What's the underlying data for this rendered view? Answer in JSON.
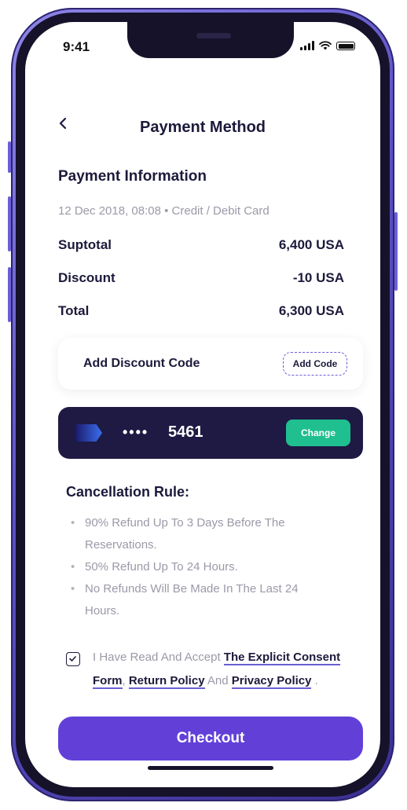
{
  "status_bar": {
    "time": "9:41"
  },
  "header": {
    "title": "Payment Method"
  },
  "payment_info": {
    "title": "Payment Information",
    "meta": "12 Dec 2018, 08:08 • Credit / Debit Card",
    "rows": [
      {
        "label": "Suptotal",
        "value": "6,400 USA"
      },
      {
        "label": "Discount",
        "value": "-10 USA"
      },
      {
        "label": "Total",
        "value": "6,300 USA"
      }
    ]
  },
  "discount": {
    "label": "Add Discount Code",
    "button": "Add Code"
  },
  "card": {
    "masked": "••••",
    "last4": "5461",
    "change_label": "Change"
  },
  "cancellation": {
    "title": "Cancellation Rule:",
    "rules": [
      "90% Refund Up To 3 Days Before The Reservations.",
      "50% Refund Up To 24 Hours.",
      "No Refunds Will Be Made In The Last 24 Hours."
    ]
  },
  "consent": {
    "prefix": "I Have Read And Accept ",
    "link1": "The Explicit Consent Form",
    "sep": ", ",
    "link2": "Return Policy",
    "and": " And ",
    "link3": "Privacy Policy",
    "suffix": " .",
    "checked": true
  },
  "checkout": {
    "label": "Checkout"
  },
  "colors": {
    "primary": "#6240d8",
    "card_bg": "#1e1a44",
    "change_green": "#1fbf8f",
    "text_dark": "#1c1a3b",
    "text_muted": "#9a9aa8"
  },
  "icons": [
    "back-chevron-icon",
    "signal-icon",
    "wifi-icon",
    "battery-icon",
    "card-logo-icon",
    "checkmark-icon"
  ]
}
